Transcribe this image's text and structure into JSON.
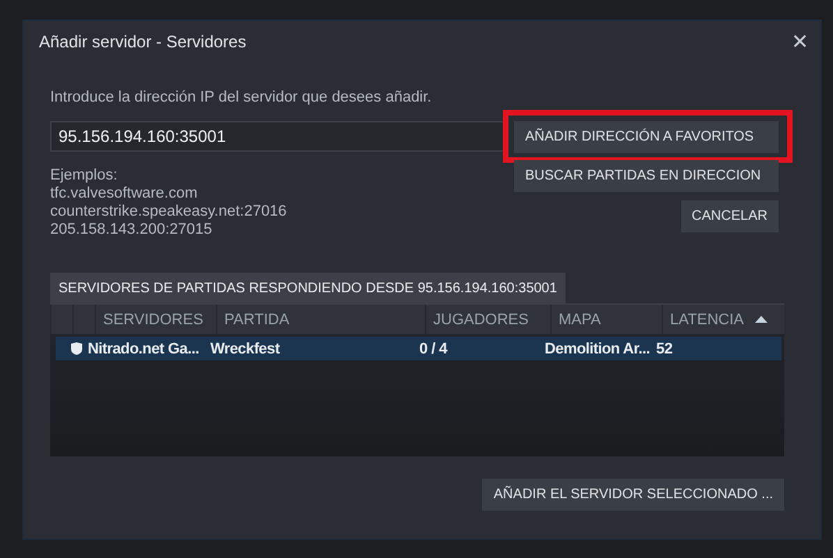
{
  "window": {
    "title": "Añadir servidor - Servidores",
    "close": "✕"
  },
  "prompt": "Introduce la dirección IP del servidor que desees añadir.",
  "address_field": {
    "value": "95.156.194.160:35001"
  },
  "examples": [
    "Ejemplos:",
    "tfc.valvesoftware.com",
    "counterstrike.speakeasy.net:27016",
    "205.158.143.200:27015"
  ],
  "side_buttons": [
    {
      "label": "AÑADIR DIRECCIÓN A FAVORITOS",
      "highlighted": true
    },
    {
      "label": "BUSCAR PARTIDAS EN DIRECCION",
      "highlighted": false
    }
  ],
  "cancel_button": "CANCELAR",
  "tabs": [
    {
      "label": "SERVIDORES DE PARTIDAS RESPONDIENDO DESDE 95.156.194.160:35001",
      "selected": true
    }
  ],
  "table": {
    "columns": [
      {
        "label": "SERVIDORES",
        "sorted": false
      },
      {
        "label": "PARTIDA",
        "sorted": false
      },
      {
        "label": "JUGADORES",
        "sorted": false
      },
      {
        "label": "MAPA",
        "sorted": false
      },
      {
        "label": "LATENCIA",
        "sorted": true
      }
    ],
    "rows": [
      {
        "selected": true,
        "secure": true,
        "cells": [
          "Nitrado.net Ga...",
          "Wreckfest",
          "0 / 4",
          "Demolition Ar...",
          "52"
        ]
      }
    ]
  },
  "add_selected_button": "AÑADIR EL SERVIDOR SELECCIONADO ..."
}
